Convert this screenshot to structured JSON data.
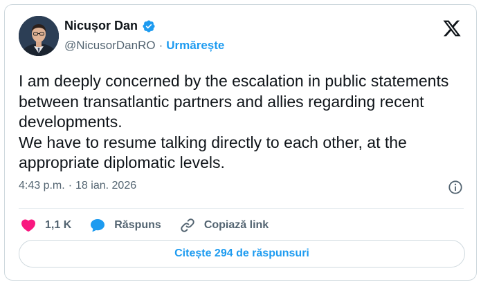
{
  "author": {
    "name": "Nicușor Dan",
    "handle": "@NicusorDanRO",
    "separator": "·",
    "follow_label": "Urmărește",
    "verified": true
  },
  "tweet": {
    "paragraphs": [
      "I am deeply concerned by the escalation in public statements between transatlantic partners and allies regarding recent developments.",
      "We have to resume talking directly to each other, at the appropriate diplomatic levels."
    ],
    "time": "4:43 p.m.",
    "date": "18 ian. 2026",
    "meta_separator": "·"
  },
  "actions": {
    "likes": "1,1 K",
    "reply_label": "Răspuns",
    "copy_link_label": "Copiază link"
  },
  "read_replies_label": "Citește 294 de răspunsuri",
  "colors": {
    "accent": "#1d9bf0",
    "like": "#f91880",
    "text": "#0f1419",
    "muted": "#536471",
    "border": "#cfd9de"
  },
  "icons": {
    "platform": "x-logo-icon",
    "verified": "verified-badge-icon",
    "info": "info-icon",
    "like": "heart-icon",
    "reply": "speech-bubble-icon",
    "copy": "link-icon"
  }
}
